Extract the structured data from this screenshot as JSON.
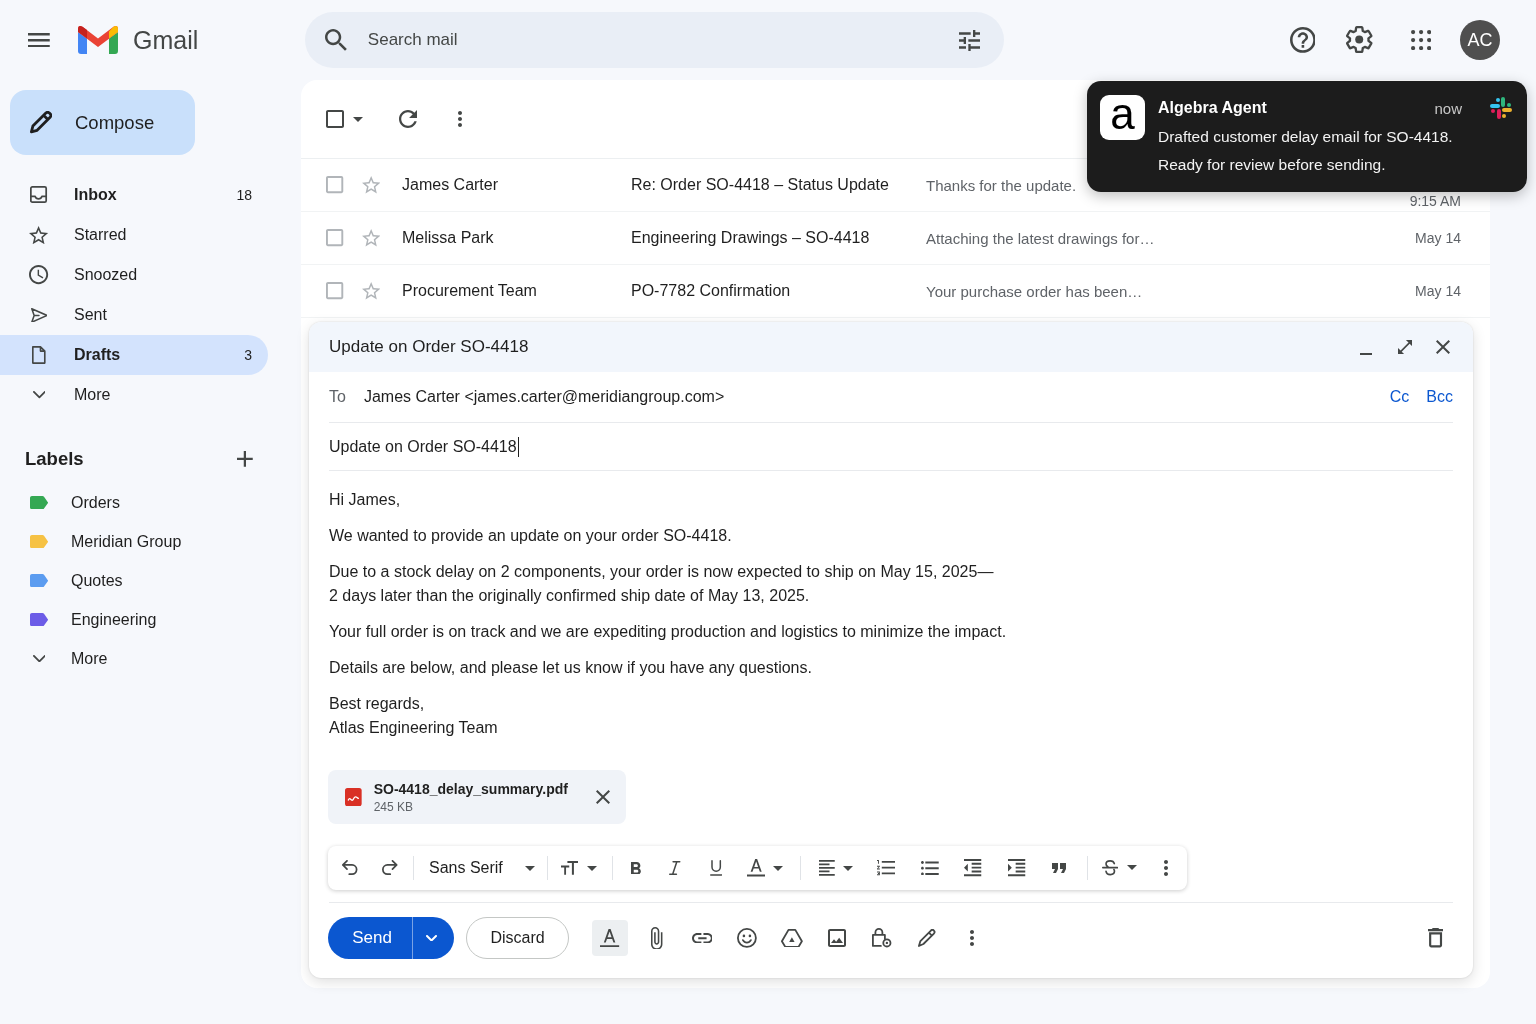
{
  "topbar": {
    "product_name": "Gmail",
    "search": {
      "placeholder": "Search mail"
    },
    "avatar": {
      "initials": "AC"
    }
  },
  "sidebar": {
    "compose": "Compose",
    "folders": [
      {
        "label": "Inbox",
        "count": "18",
        "selected": false
      },
      {
        "label": "Starred",
        "selected": false
      },
      {
        "label": "Snoozed",
        "selected": false
      },
      {
        "label": "Sent",
        "selected": false
      },
      {
        "label": "Drafts",
        "count": "3",
        "selected": true
      }
    ],
    "more": {
      "label": "More",
      "expanded": false
    },
    "labels_title": "Labels",
    "labels": [
      {
        "name": "Orders",
        "color": "#34a853"
      },
      {
        "name": "Meridian Group",
        "color": "#f6c244"
      },
      {
        "name": "Quotes",
        "color": "#5b9cf0"
      },
      {
        "name": "Engineering",
        "color": "#6c5ce7"
      }
    ],
    "labels_more": {
      "label": "More",
      "expanded": false
    }
  },
  "mail_list": {
    "select_all": {
      "checked": false
    },
    "rows": [
      {
        "sender": "James Carter",
        "subject": "Re: Order SO-4418 – Status Update",
        "snippet": "Thanks for the update.",
        "time": "9:15 AM",
        "checked": false,
        "starred": false
      },
      {
        "sender": "Melissa Park",
        "subject": "Engineering Drawings – SO-4418",
        "snippet": "Attaching the latest drawings for…",
        "time": "May 14",
        "checked": false,
        "starred": false
      },
      {
        "sender": "Procurement Team",
        "subject": "PO-7782 Confirmation",
        "snippet": "Your purchase order has been…",
        "time": "May 14",
        "checked": false,
        "starred": false
      }
    ]
  },
  "compose": {
    "title": "Update on Order SO-4418",
    "to_label": "To",
    "recipient": "James Carter <james.carter@meridiangroup.com>",
    "cc": "Cc",
    "bcc": "Bcc",
    "subject": {
      "value": "Update on Order SO-4418",
      "focused": true
    },
    "body": [
      [
        "Hi James,"
      ],
      [
        "We wanted to provide an update on your order SO-4418."
      ],
      [
        "Due to a stock delay on 2 components, your order is now expected to ship on May 15, 2025—",
        "2 days later than the originally confirmed ship date of May 13, 2025."
      ],
      [
        "Your full order is on track and we are expediting production and logistics to minimize the impact."
      ],
      [
        "Details are below, and please let us know if you have any questions."
      ],
      [
        "Best regards,",
        "Atlas Engineering Team"
      ]
    ],
    "attachment": {
      "name": "SO-4418_delay_summary.pdf",
      "size": "245 KB"
    },
    "formatting_shown": true,
    "font": "Sans Serif",
    "send": "Send",
    "discard": "Discard"
  },
  "notification": {
    "app_letter": "a",
    "app": "Algebra Agent",
    "time": "now",
    "lines": [
      "Drafted customer delay email for SO-4418.",
      "Ready for review before sending."
    ]
  }
}
